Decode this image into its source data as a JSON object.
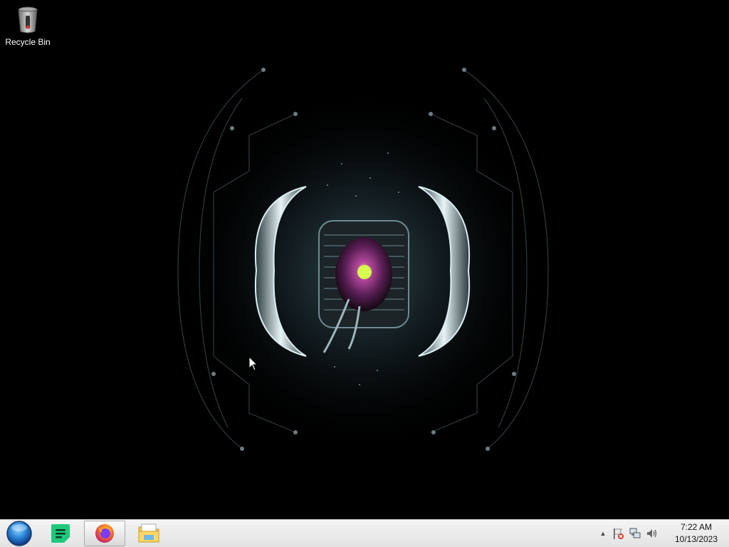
{
  "desktop": {
    "icons": [
      {
        "label": "Recycle Bin",
        "icon": "recycle-bin-icon"
      }
    ],
    "wallpaper": "dark-sci-fi-orb-wallpaper"
  },
  "taskbar": {
    "start": {
      "icon": "start-orb-icon"
    },
    "apps": [
      {
        "name": "notes",
        "icon": "notes-app-icon",
        "active": false
      },
      {
        "name": "firefox",
        "icon": "firefox-icon",
        "active": true
      },
      {
        "name": "file-explorer",
        "icon": "folder-explorer-icon",
        "active": false
      }
    ],
    "tray": {
      "expand_glyph": "▲",
      "icons": [
        "action-center-flag-icon",
        "network-icon",
        "volume-icon"
      ],
      "time": "7:22 AM",
      "date": "10/13/2023"
    }
  },
  "colors": {
    "taskbar_bg": "#ececec",
    "desktop_bg": "#000000",
    "accent_green": "#1fc97a",
    "start_blue": "#2e86d8"
  }
}
